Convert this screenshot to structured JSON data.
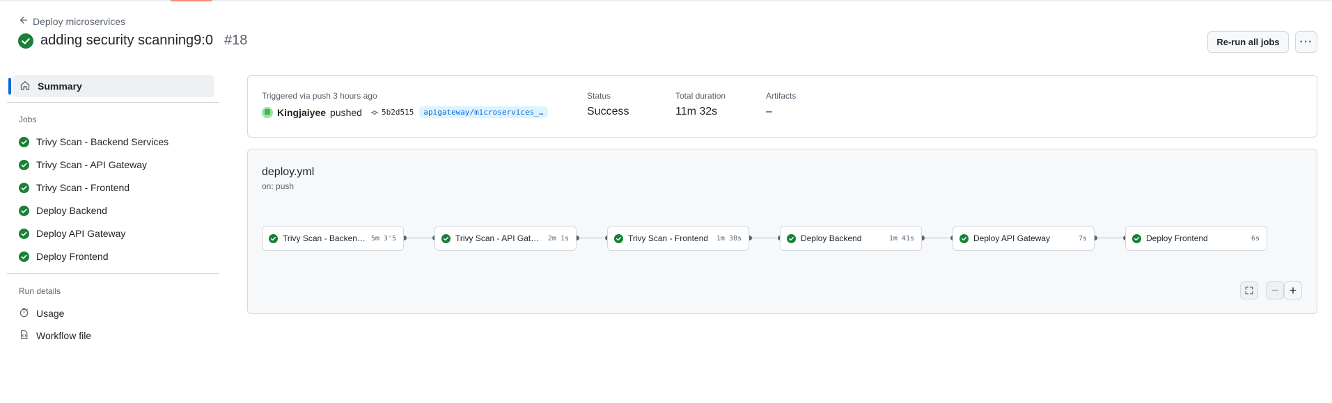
{
  "header": {
    "back_label": "Deploy microservices",
    "title": "adding security scanning9:0",
    "run_number": "#18",
    "rerun_label": "Re-run all jobs",
    "more_label": "···"
  },
  "sidebar": {
    "summary_label": "Summary",
    "jobs_heading": "Jobs",
    "jobs": [
      {
        "label": "Trivy Scan - Backend Services"
      },
      {
        "label": "Trivy Scan - API Gateway"
      },
      {
        "label": "Trivy Scan - Frontend"
      },
      {
        "label": "Deploy Backend"
      },
      {
        "label": "Deploy API Gateway"
      },
      {
        "label": "Deploy Frontend"
      }
    ],
    "run_details_heading": "Run details",
    "usage_label": "Usage",
    "workflow_file_label": "Workflow file"
  },
  "summary": {
    "triggered_label": "Triggered via push 3 hours ago",
    "user": "Kingjaiyee",
    "pushed_word": "pushed",
    "commit": "5b2d515",
    "branch": "apigateway/microservices_…",
    "status_label": "Status",
    "status_value": "Success",
    "duration_label": "Total duration",
    "duration_value": "11m 32s",
    "artifacts_label": "Artifacts",
    "artifacts_value": "–"
  },
  "workflow": {
    "file": "deploy.yml",
    "trigger": "on: push",
    "jobs": [
      {
        "name": "Trivy Scan - Backend Ser…",
        "duration": "5m 3'5"
      },
      {
        "name": "Trivy Scan - API Gateway",
        "duration": "2m 1s"
      },
      {
        "name": "Trivy Scan - Frontend",
        "duration": "1m 38s"
      },
      {
        "name": "Deploy Backend",
        "duration": "1m 41s"
      },
      {
        "name": "Deploy API Gateway",
        "duration": "7s"
      },
      {
        "name": "Deploy Frontend",
        "duration": "6s"
      }
    ]
  },
  "colors": {
    "success": "#1a7f37",
    "accent": "#0969da"
  }
}
